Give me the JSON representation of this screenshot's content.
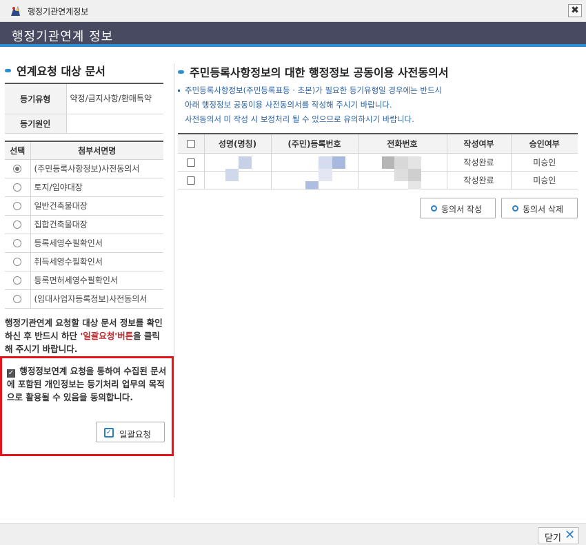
{
  "window": {
    "title": "행정기관연계정보",
    "close_symbol": "✖"
  },
  "header": {
    "title": "행정기관연계 정보"
  },
  "left": {
    "section_title": "연계요청 대상 문서",
    "info_rows": [
      {
        "label": "등기유형",
        "value": "약정/금지사항/환매특약"
      },
      {
        "label": "등기원인",
        "value": ""
      }
    ],
    "doc_table": {
      "headers": [
        "선택",
        "첨부서면명"
      ],
      "items": [
        {
          "name": "(주민등록사항정보)사전동의서",
          "selected": true
        },
        {
          "name": "토지/임야대장",
          "selected": false
        },
        {
          "name": "일반건축물대장",
          "selected": false
        },
        {
          "name": "집합건축물대장",
          "selected": false
        },
        {
          "name": "등록세영수필확인서",
          "selected": false
        },
        {
          "name": "취득세영수필확인서",
          "selected": false
        },
        {
          "name": "등록면허세영수필확인서",
          "selected": false
        },
        {
          "name": "(임대사업자등록정보)사전동의서",
          "selected": false
        }
      ]
    },
    "notice_part1": "행정기관연계 요청할 대상 문서 정보를 확인하신 후 반드시 하단 ",
    "notice_highlight": "'일괄요청'버튼",
    "notice_part2": "을 클릭해 주시기 바랍니다.",
    "consent_checked": true,
    "consent_text": "행정정보연계 요청을 통하여 수집된 문서에 포함된 개인정보는 등기처리 업무의 목적으로 활용될 수 있음을 동의합니다.",
    "bulk_button": "일괄요청"
  },
  "right": {
    "section_title": "주민등록사항정보의 대한 행정정보 공동이용 사전동의서",
    "desc_lines": [
      "주민등록사항정보(주민등록표등 · 초본)가 필요한 등기유형일 경우에는 반드시",
      "아래 행정정보 공동이용 사전동의서를 작성해 주시기 바랍니다.",
      "사전동의서 미 작성 시 보정처리 될 수 있으므로 유의하시기 바랍니다."
    ],
    "grid": {
      "headers": [
        "성명(명칭)",
        "(주민)등록번호",
        "전화번호",
        "작성여부",
        "승인여부"
      ],
      "rows": [
        {
          "status": "작성완료",
          "approval": "미승인"
        },
        {
          "status": "작성완료",
          "approval": "미승인"
        }
      ]
    },
    "buttons": {
      "write": "동의서 작성",
      "delete": "동의서 삭제"
    }
  },
  "footer": {
    "close_label": "닫기",
    "close_icon": "✕"
  },
  "colors": {
    "header_bg": "#474a61",
    "accent": "#2a8fd6",
    "highlight_red": "#c0282b",
    "box_border": "#e5141b",
    "desc_text": "#2a62a4"
  }
}
